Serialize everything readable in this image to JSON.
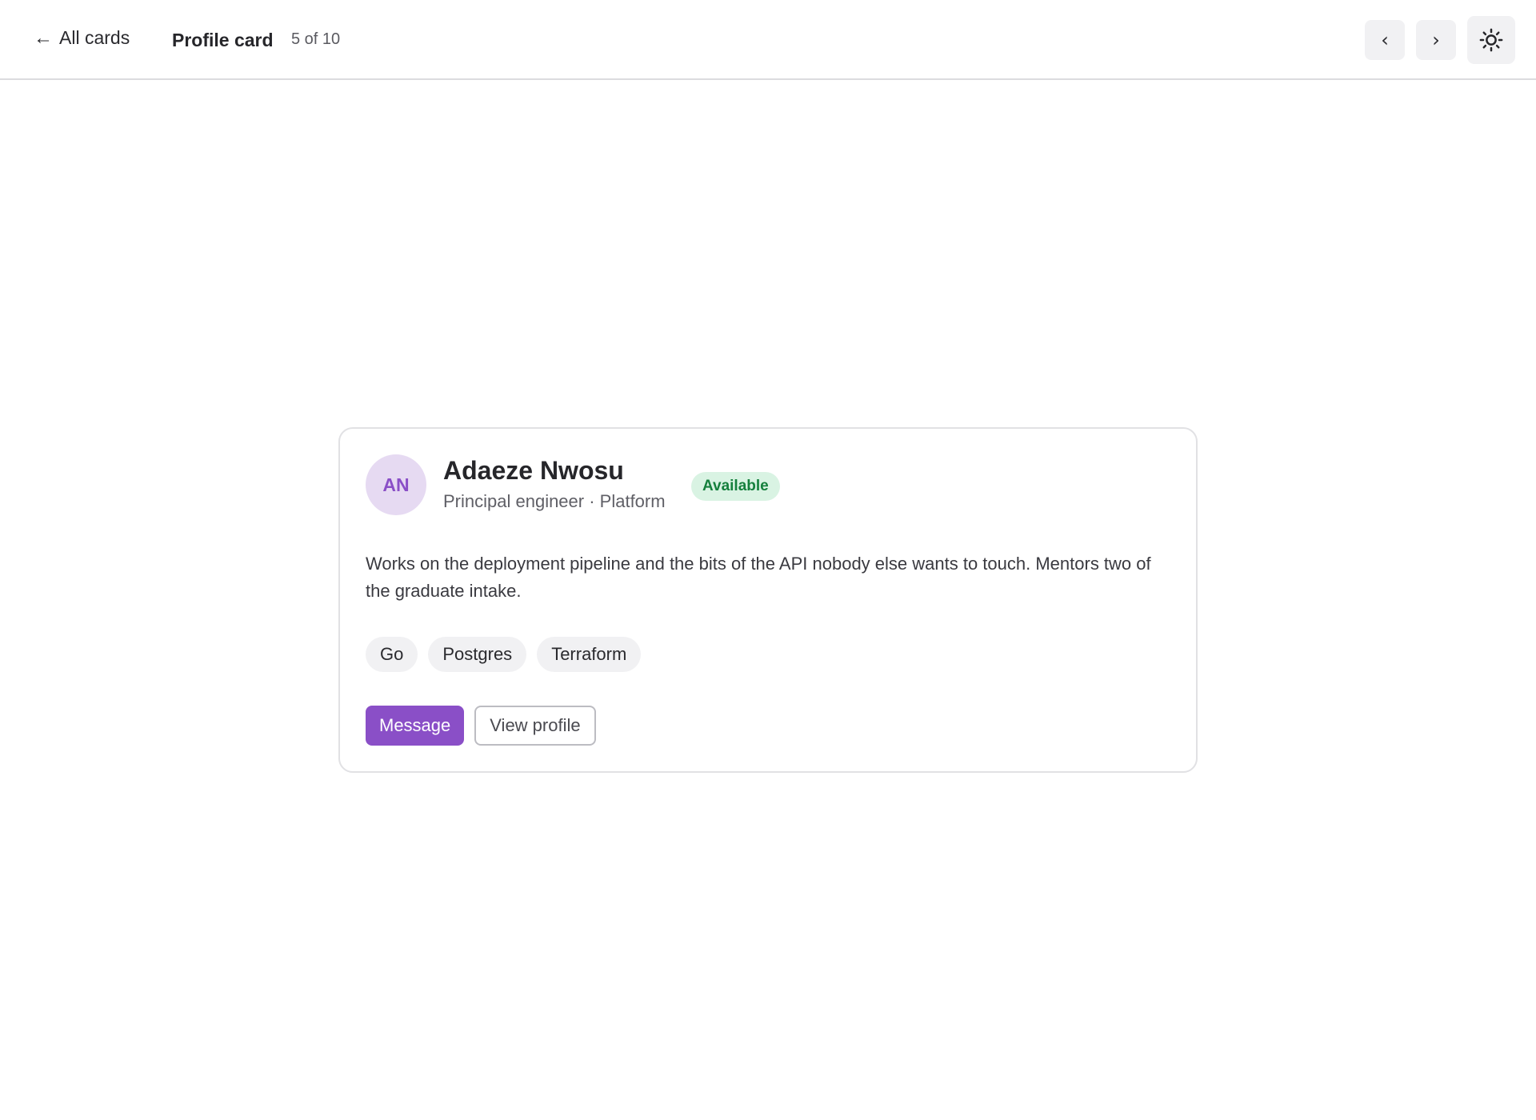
{
  "header": {
    "back_label": "All cards",
    "title": "Profile card",
    "counter": "5 of 10",
    "prev_label": "‹",
    "next_label": "›"
  },
  "profile": {
    "initials": "AN",
    "name": "Adaeze Nwosu",
    "role": "Principal engineer · Platform",
    "status": "Available",
    "bio": "Works on the deployment pipeline and the bits of the API nobody else wants to touch. Mentors two of the graduate intake.",
    "tags": [
      "Go",
      "Postgres",
      "Terraform"
    ],
    "primary_action": "Message",
    "secondary_action": "View profile"
  },
  "colors": {
    "accent": "#8a4fc7",
    "avatar_bg": "#e6daf2",
    "status_bg": "#d9f3e3",
    "status_text": "#15803d"
  },
  "icons": {
    "back": "arrow-left-icon",
    "theme": "sun-icon"
  }
}
